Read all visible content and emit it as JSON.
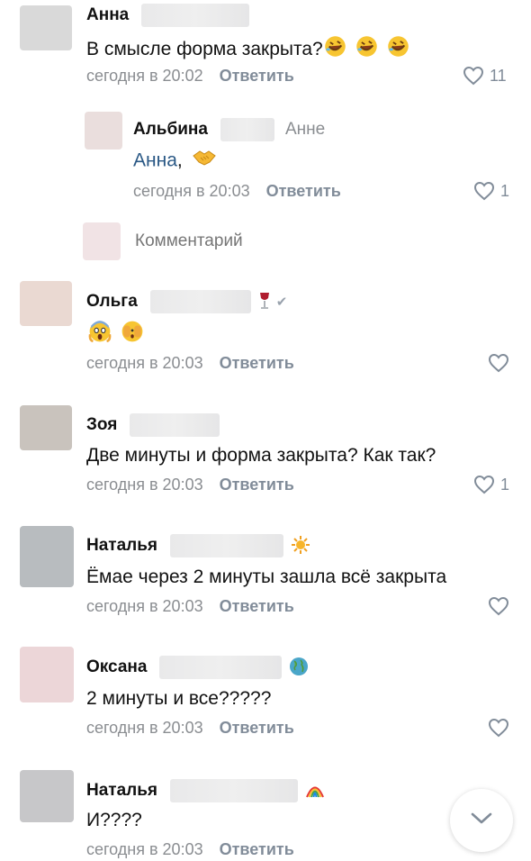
{
  "comments": [
    {
      "author": "Анна",
      "text": "В смысле форма закрыта?",
      "emojis": [
        "rolling-on-floor-laughing",
        "rolling-on-floor-laughing",
        "rolling-on-floor-laughing"
      ],
      "time": "сегодня в 20:02",
      "reply_label": "Ответить",
      "likes": "11",
      "avatar_color": "#d9d9d9"
    },
    {
      "author": "Альбина",
      "reply_to": "Анне",
      "mention": "Анна",
      "text_suffix": ",",
      "emojis": [
        "handshake"
      ],
      "time": "сегодня в 20:03",
      "reply_label": "Ответить",
      "likes": "1",
      "avatar_color": "#eadedd"
    },
    {
      "author": "Ольга",
      "name_icon": "wine-glass",
      "verified": "✔",
      "emojis": [
        "screaming-face",
        "peeking-face"
      ],
      "time": "сегодня в 20:03",
      "reply_label": "Ответить",
      "likes": "",
      "avatar_color": "#ead9d2"
    },
    {
      "author": "Зоя",
      "text": "Две минуты и форма закрыта? Как так?",
      "time": "сегодня в 20:03",
      "reply_label": "Ответить",
      "likes": "1",
      "avatar_color": "#c9c3bd"
    },
    {
      "author": "Наталья",
      "name_icon": "sun",
      "text": "Ёмае через 2 минуты зашла всё закрыта",
      "time": "сегодня в 20:03",
      "reply_label": "Ответить",
      "likes": "",
      "avatar_color": "#b8bcbf"
    },
    {
      "author": "Оксана",
      "name_icon": "globe",
      "text": "2 минуты и все?????",
      "time": "сегодня в 20:03",
      "reply_label": "Ответить",
      "likes": "",
      "avatar_color": "#ecd6d8"
    },
    {
      "author": "Наталья",
      "name_icon": "rainbow",
      "text": "И????",
      "time": "сегодня в 20:03",
      "reply_label": "Ответить",
      "likes": "",
      "avatar_color": "#c7c7c9"
    }
  ],
  "comment_input": {
    "placeholder": "Комментарий",
    "avatar_color": "#f1e3e5"
  },
  "colors": {
    "link": "#2a5885",
    "secondary": "#818c99",
    "text": "#111111"
  }
}
